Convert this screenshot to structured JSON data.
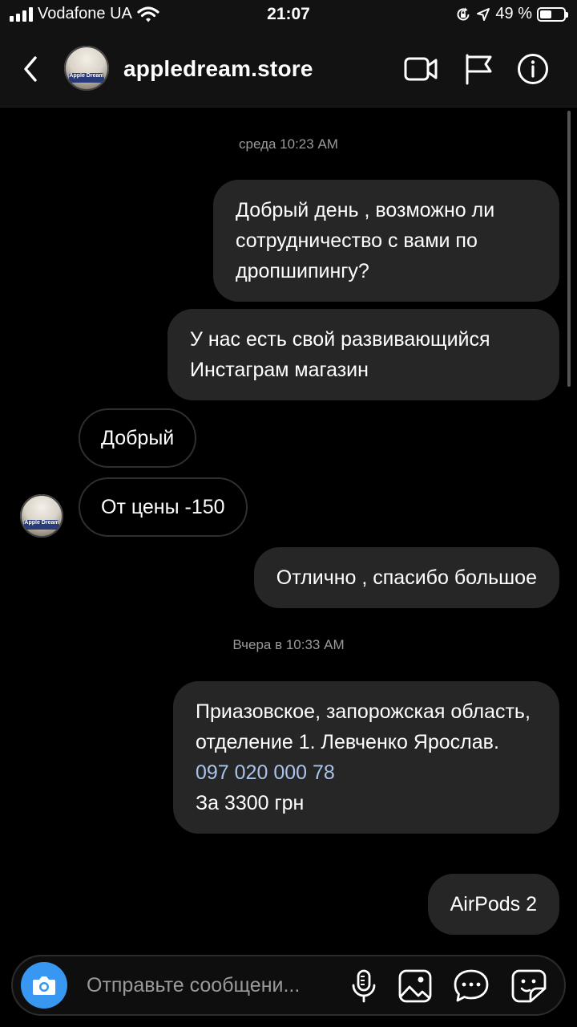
{
  "status_bar": {
    "carrier": "Vodafone UA",
    "time": "21:07",
    "battery_text": "49 %",
    "battery_level": 0.49,
    "icons": [
      "signal-icon",
      "wifi-icon",
      "orientation-lock-icon",
      "location-arrow-icon",
      "battery-icon"
    ]
  },
  "header": {
    "title": "appledream.store",
    "avatar_badge": "Apple Dream",
    "icons": [
      "back-chevron-icon",
      "video-call-icon",
      "flag-icon",
      "info-icon"
    ]
  },
  "chat": {
    "timestamp_1": "среда 10:23 AM",
    "messages": [
      {
        "from": "me",
        "text": "Добрый день , возможно ли сотрудничество с вами по дропшипингу?"
      },
      {
        "from": "me",
        "text": "У нас есть свой развивающийся Инстаграм магазин"
      },
      {
        "from": "them",
        "text": "Добрый"
      },
      {
        "from": "them",
        "text": "От цены -150"
      },
      {
        "from": "me",
        "text": "Отлично , спасибо большое"
      }
    ],
    "timestamp_2": "Вчера в 10:33 AM",
    "address_message": {
      "address": "Приазовское, запорожская область, отделение 1. Левченко Ярослав.",
      "phone": "097 020 000 78",
      "price": "За 3300 грн"
    },
    "last_message": "AirPods 2"
  },
  "composer": {
    "placeholder": "Отправьте сообщени...",
    "icons": [
      "camera-icon",
      "microphone-icon",
      "gallery-icon",
      "chat-bubble-icon",
      "sticker-icon"
    ]
  },
  "colors": {
    "background": "#000000",
    "header_bg": "#121212",
    "outgoing_bubble": "#262626",
    "incoming_border": "#2f2f2f",
    "camera_button": "#3897f0",
    "link": "#a9c3ea"
  }
}
